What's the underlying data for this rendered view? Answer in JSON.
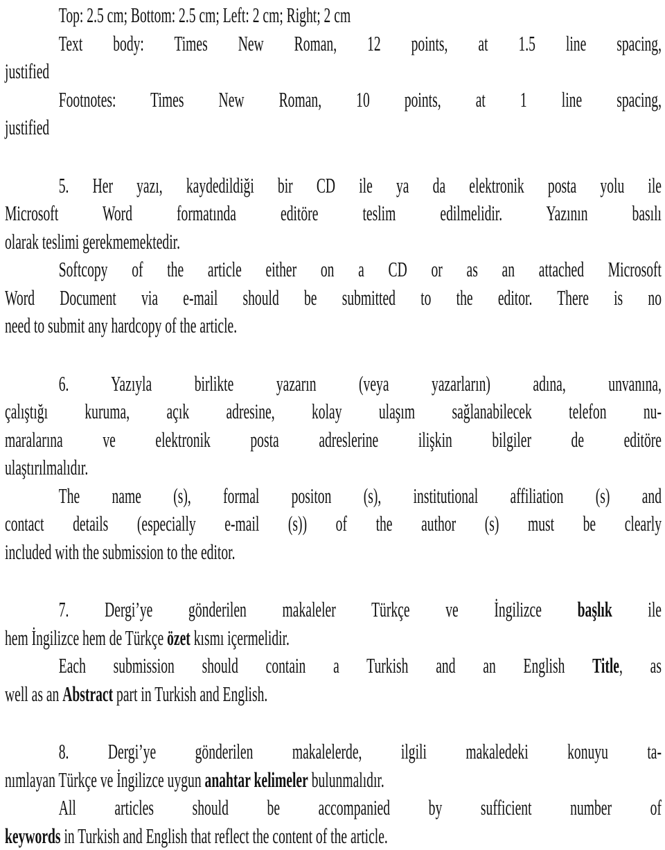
{
  "document": {
    "formatting": {
      "margins": "Top: 2.5 cm; Bottom: 2.5 cm; Left: 2 cm; Right; 2 cm",
      "text_body_l1": "Text body: Times New Roman, 12 points, at 1.5 line spacing,",
      "text_body_l2": "justified",
      "footnotes_l1": "Footnotes: Times New Roman, 10 points, at 1 line spacing,",
      "footnotes_l2": "justified"
    },
    "item5": {
      "tr_l1": "5.  Her yazı, kaydedildiği bir CD ile ya da elektronik posta yolu ile",
      "tr_l2": "Microsoft Word formatında editöre teslim edilmelidir. Yazının basılı",
      "tr_l3": "olarak teslimi gerekmemektedir.",
      "en_l1": "Softcopy of the article either on a CD or as an attached Microsoft",
      "en_l2": "Word Document via e-mail should be submitted to the editor. There is no",
      "en_l3": "need to submit any hardcopy of the article."
    },
    "item6": {
      "tr_l1": "6. Yazıyla birlikte yazarın (veya yazarların) adına, unvanına,",
      "tr_l2": "çalıştığı kuruma, açık adresine, kolay ulaşım sağlanabilecek telefon nu-",
      "tr_l3": "maralarına ve elektronik posta adreslerine ilişkin bilgiler de editöre",
      "tr_l4": "ulaştırılmalıdır.",
      "en_l1": "The name (s), formal positon (s), institutional affiliation (s) and",
      "en_l2": "contact details (especially e-mail (s)) of the author (s) must be clearly",
      "en_l3": "included with the submission to the editor."
    },
    "item7": {
      "tr_l1_a": "7.  Dergi’ye gönderilen makaleler Türkçe ve İngilizce ",
      "tr_l1_b": "başlık",
      "tr_l1_c": " ile",
      "tr_l2_a": "hem İngilizce hem de Türkçe ",
      "tr_l2_b": "özet",
      "tr_l2_c": " kısmı içermelidir.",
      "en_l1_a": "Each submission should contain a Turkish and an English ",
      "en_l1_b": "Title",
      "en_l1_c": ", as",
      "en_l2_a": "well as an ",
      "en_l2_b": "Abstract",
      "en_l2_c": " part in Turkish and English."
    },
    "item8": {
      "tr_l1": "8.  Dergi’ye gönderilen makalelerde, ilgili makaledeki konuyu ta-",
      "tr_l2_a": "nımlayan Türkçe ve İngilizce uygun ",
      "tr_l2_b": "anahtar kelimeler",
      "tr_l2_c": " bulunmalıdır.",
      "en_l1": "All articles should be accompanied by sufficient number of",
      "en_l2_a": "keywords",
      "en_l2_b": " in Turkish and English that reflect the content of the article."
    }
  }
}
